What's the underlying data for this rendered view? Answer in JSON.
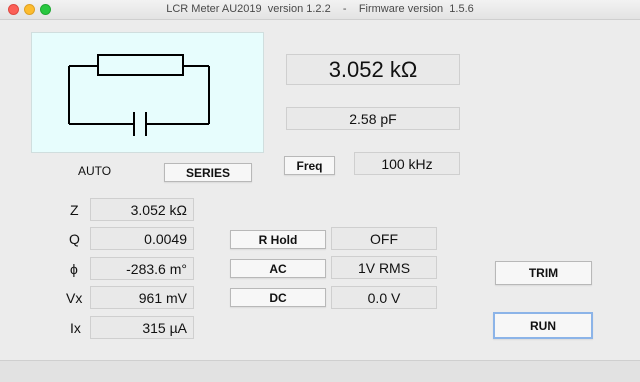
{
  "window": {
    "title": "LCR Meter AU2019  version 1.2.2    -    Firmware version  1.5.6"
  },
  "display": {
    "primary_value": "3.052 kΩ",
    "secondary_value": "2.58 pF",
    "mode": "AUTO",
    "circuit_button": "SERIES",
    "freq_button": "Freq",
    "freq_value": "100 kHz"
  },
  "measurements": [
    {
      "label": "Z",
      "value": "3.052 kΩ"
    },
    {
      "label": "Q",
      "value": "0.0049"
    },
    {
      "label": "ϕ",
      "value": "-283.6 m°"
    },
    {
      "label": "Vx",
      "value": "961 mV"
    },
    {
      "label": "Ix",
      "value": "315 µA"
    }
  ],
  "controls": [
    {
      "button": "R Hold",
      "value": "OFF"
    },
    {
      "button": "AC",
      "value": "1V RMS"
    },
    {
      "button": "DC",
      "value": "0.0 V"
    }
  ],
  "actions": {
    "trim": "TRIM",
    "run": "RUN"
  }
}
